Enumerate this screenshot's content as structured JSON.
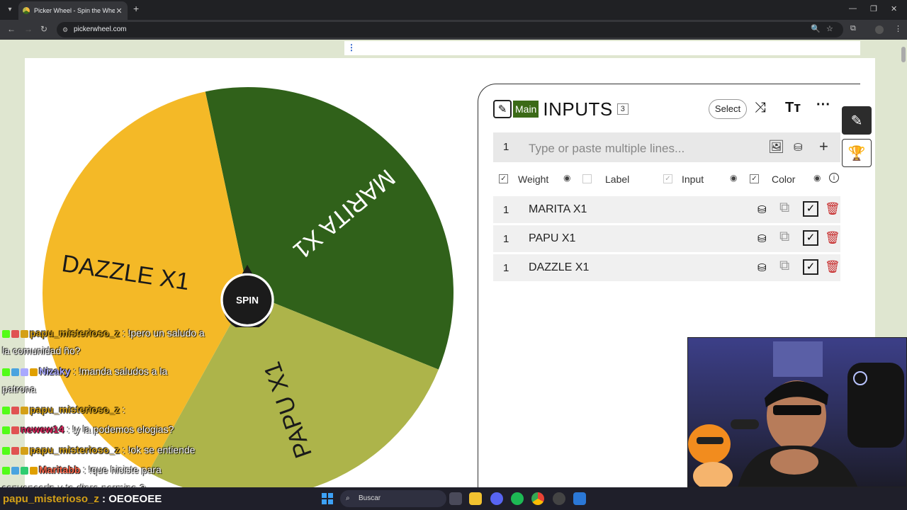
{
  "browser": {
    "tab_title": "Picker Wheel - Spin the Wheel",
    "tab_close": "✕",
    "new_tab": "+",
    "url": "pickerwheel.com",
    "back": "←",
    "forward": "→",
    "reload": "↻",
    "minimize": "—",
    "restore": "❐",
    "close": "✕"
  },
  "wheel": {
    "spin_label": "SPIN",
    "segments": [
      {
        "label": "MARITA X1",
        "color": "#30611a"
      },
      {
        "label": "PAPU X1",
        "color": "#adb44a"
      },
      {
        "label": "DAZZLE X1",
        "color": "#f4b927"
      }
    ]
  },
  "inputs_panel": {
    "main_badge": "Main",
    "title": "INPUTS",
    "count": "3",
    "select_button": "Select",
    "new_line_number": "1",
    "placeholder": "Type or paste multiple lines...",
    "options": {
      "weight": "Weight",
      "label": "Label",
      "input": "Input",
      "color": "Color"
    },
    "entries": [
      {
        "weight": "1",
        "text": "MARITA X1"
      },
      {
        "weight": "1",
        "text": "PAPU X1"
      },
      {
        "weight": "1",
        "text": "DAZZLE X1"
      }
    ]
  },
  "chat": {
    "lines": [
      {
        "user": "papu_misterioso_z",
        "user_color": "#d4a017",
        "message": " : !pero un saludo a"
      },
      {
        "user": "",
        "user_color": "#ffffff",
        "message": "la comunidad ño?"
      },
      {
        "user": "Nizaky",
        "user_color": "#a9a9ff",
        "message": " : !manda saludos a la"
      },
      {
        "user": "",
        "user_color": "#ffffff",
        "message": "patrona"
      },
      {
        "user": "papu_misterioso_z",
        "user_color": "#d4a017",
        "message": " : "
      },
      {
        "user": "newew14",
        "user_color": "#e0245e",
        "message": " : !y la podemos elogias?"
      },
      {
        "user": "papu_misterioso_z",
        "user_color": "#d4a017",
        "message": " : !ok se entiende"
      },
      {
        "user": "Maritabb",
        "user_color": "#ff6a4d",
        "message": " : !que hiciste para"
      },
      {
        "user": "",
        "user_color": "#ffffff",
        "message": "convencerla y te diera permiso ?"
      }
    ],
    "bottom_user": "papu_misterioso_z",
    "bottom_message": " : OEOEOEE"
  },
  "taskbar": {
    "search_label": "Buscar"
  },
  "colors": {
    "accent_green": "#3b6a17",
    "delete_red": "#c62828"
  }
}
